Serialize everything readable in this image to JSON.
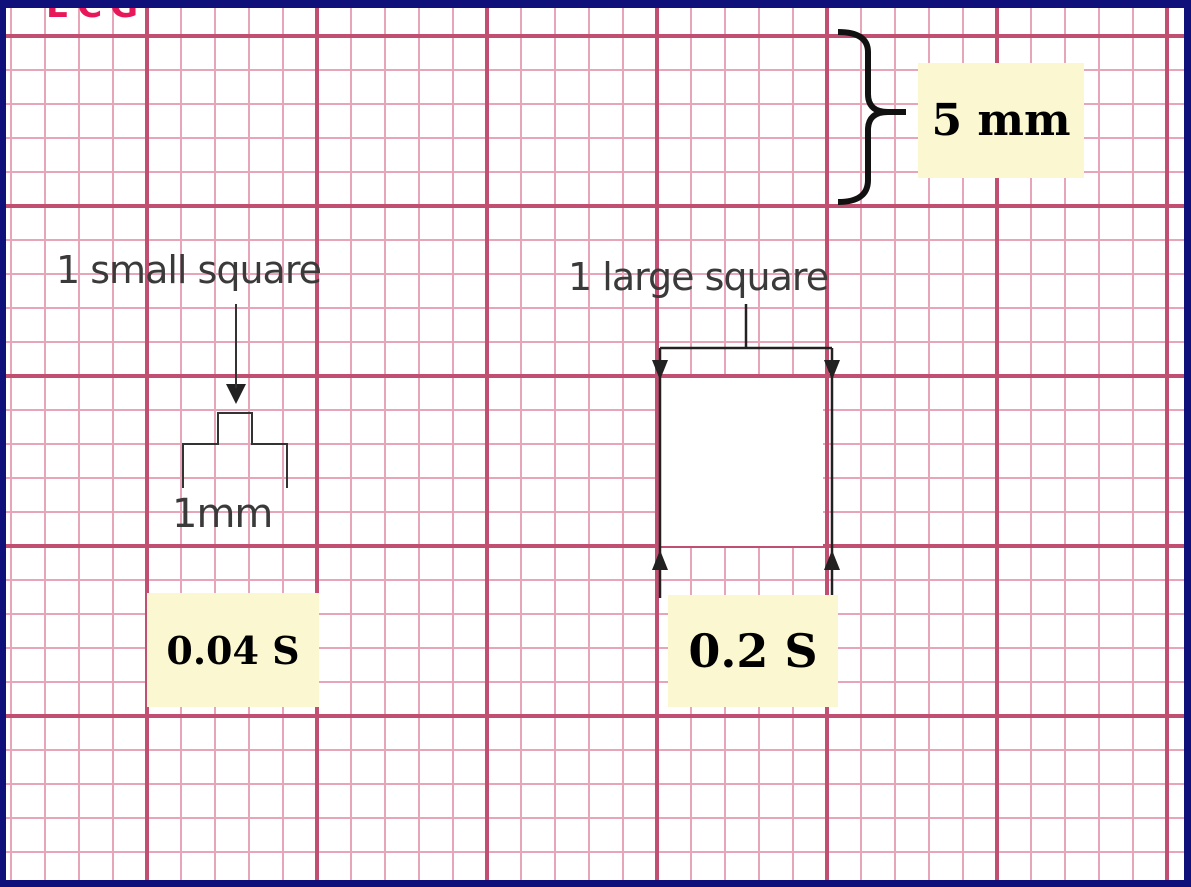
{
  "labels": {
    "small_square": "1 small square",
    "large_square": "1 large square",
    "small_size": "1mm",
    "large_height": "5 mm",
    "small_time": "0.04 S",
    "large_time": "0.2 S"
  },
  "colors": {
    "border": "#10107a",
    "grid_major": "#c14f72",
    "grid_minor": "#e6a5b8",
    "callout_bg": "#fbf7d0",
    "label_text": "#3a3a3a"
  }
}
